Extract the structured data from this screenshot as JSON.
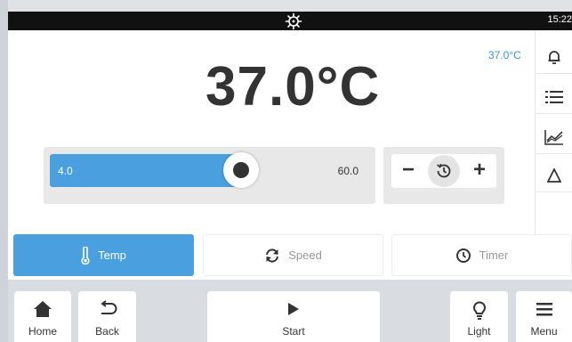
{
  "status_bar": {
    "time": "15:22",
    "center_icon": "sun-gear-icon"
  },
  "display": {
    "current_temperature": "37.0°C",
    "setpoint": "37.0°C"
  },
  "slider": {
    "min_label": "4.0",
    "max_label": "60.0",
    "value_fraction": 0.62
  },
  "stepper": {
    "minus": "−",
    "plus": "+",
    "center_icon": "history-icon"
  },
  "side_panel": {
    "icons": [
      "bell-icon",
      "list-icon",
      "graph-icon",
      "delta-icon"
    ]
  },
  "tabs": [
    {
      "label": "Temp",
      "icon": "thermometer-icon",
      "active": true
    },
    {
      "label": "Speed",
      "icon": "refresh-icon",
      "active": false
    },
    {
      "label": "Timer",
      "icon": "clock-icon",
      "active": false
    }
  ],
  "bottom_bar": {
    "home": "Home",
    "back": "Back",
    "start": "Start",
    "light": "Light",
    "menu": "Menu"
  },
  "colors": {
    "accent": "#4a9fdf",
    "statusbar": "#111111",
    "text": "#333333"
  }
}
